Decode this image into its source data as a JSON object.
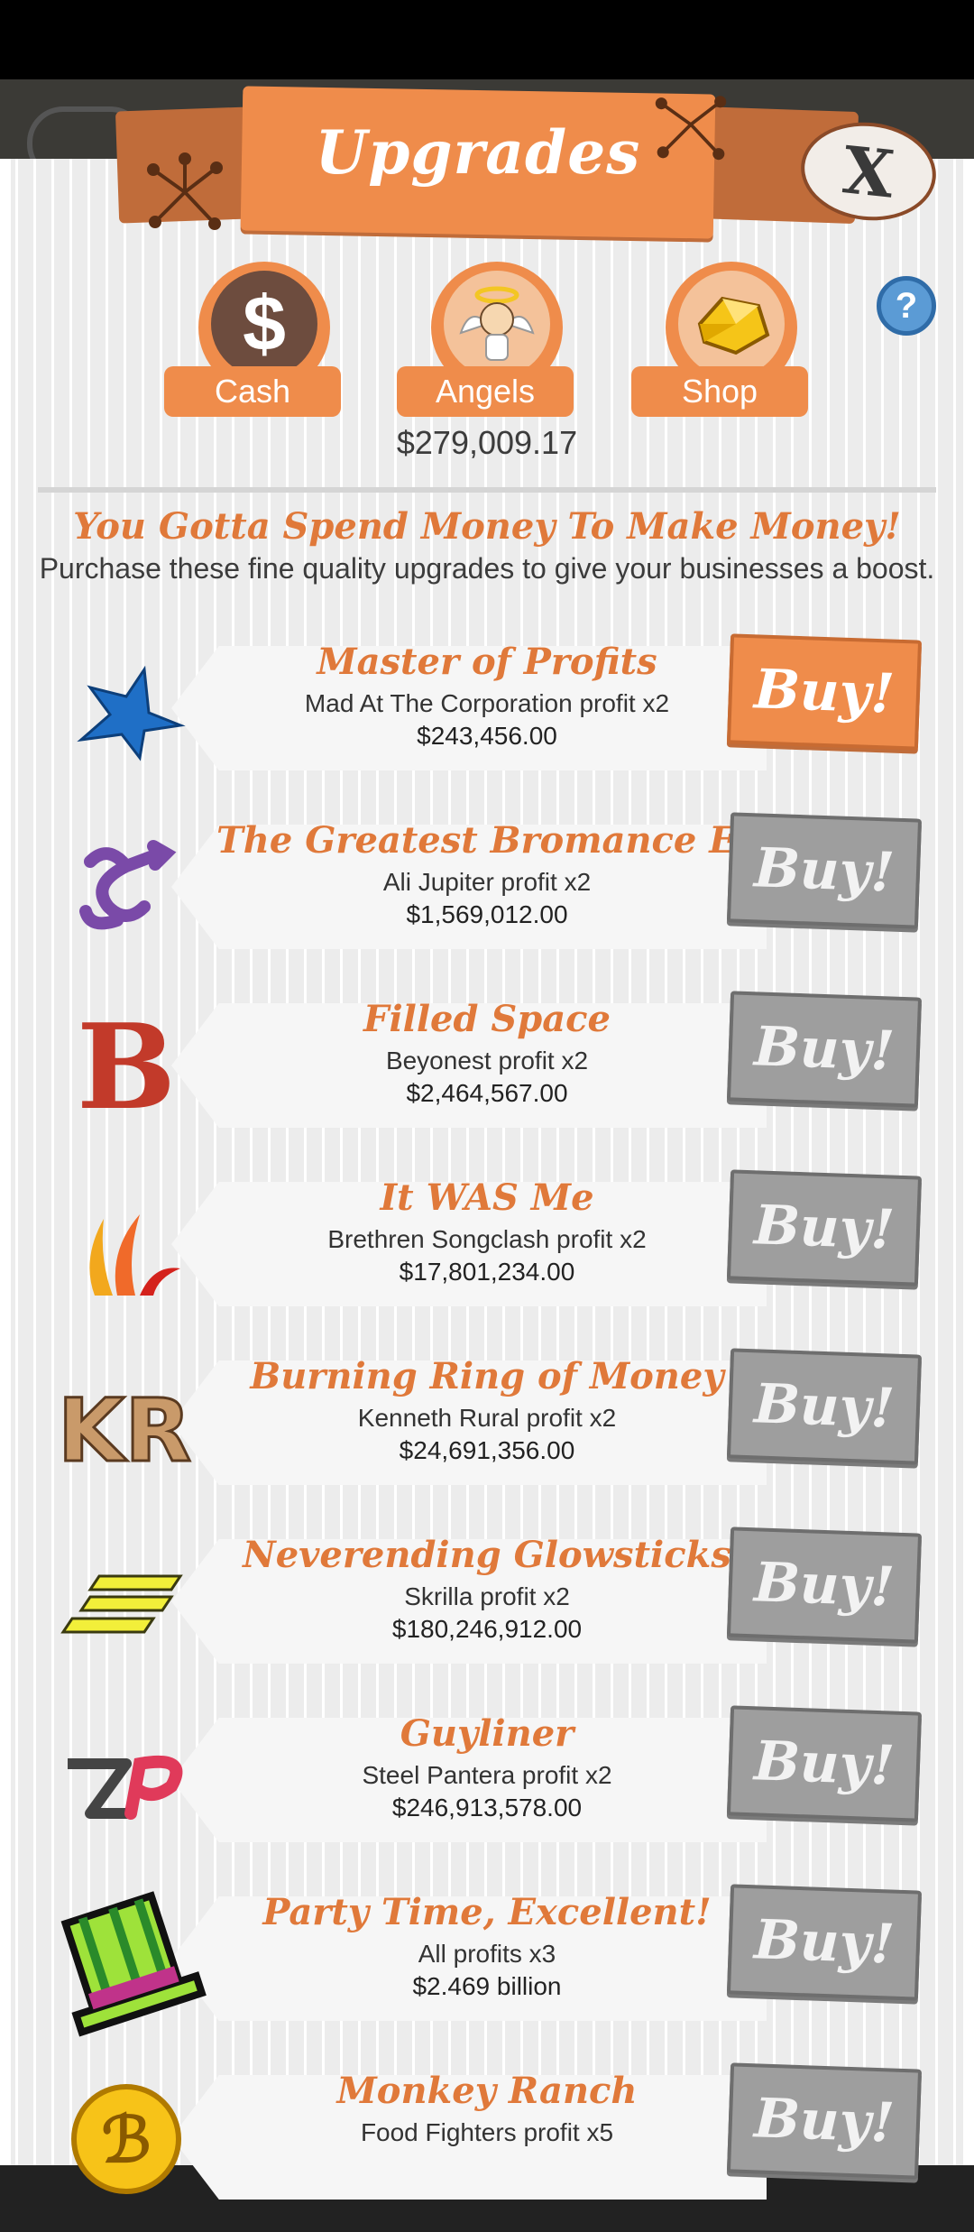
{
  "header": {
    "title": "Upgrades",
    "close_label": "X",
    "help_label": "?"
  },
  "tabs": [
    {
      "label": "Cash",
      "icon": "dollar-icon"
    },
    {
      "label": "Angels",
      "icon": "angel-icon"
    },
    {
      "label": "Shop",
      "icon": "gold-gem-icon"
    }
  ],
  "balance": "$279,009.17",
  "tagline": "You Gotta Spend Money To Make Money!",
  "subline": "Purchase these fine quality upgrades to give your businesses a boost.",
  "upgrades": [
    {
      "name": "Master of Profits",
      "desc": "Mad At The Corporation profit x2",
      "price": "$243,456.00",
      "buy": "Buy!",
      "active": true,
      "icon": "blue-star-icon"
    },
    {
      "name": "The Greatest Bromance Ever Sold",
      "desc": "Ali Jupiter profit x2",
      "price": "$1,569,012.00",
      "buy": "Buy!",
      "active": false,
      "icon": "purple-symbol-icon"
    },
    {
      "name": "Filled Space",
      "desc": "Beyonest profit x2",
      "price": "$2,464,567.00",
      "buy": "Buy!",
      "active": false,
      "icon": "letter-b-icon"
    },
    {
      "name": "It WAS Me",
      "desc": "Brethren Songclash profit x2",
      "price": "$17,801,234.00",
      "buy": "Buy!",
      "active": false,
      "icon": "flames-icon"
    },
    {
      "name": "Burning Ring of Money",
      "desc": "Kenneth Rural profit x2",
      "price": "$24,691,356.00",
      "buy": "Buy!",
      "active": false,
      "icon": "kr-logo-icon"
    },
    {
      "name": "Neverending Glowsticks",
      "desc": "Skrilla profit x2",
      "price": "$180,246,912.00",
      "buy": "Buy!",
      "active": false,
      "icon": "glowsticks-icon"
    },
    {
      "name": "Guyliner",
      "desc": "Steel Pantera profit x2",
      "price": "$246,913,578.00",
      "buy": "Buy!",
      "active": false,
      "icon": "sp-logo-icon"
    },
    {
      "name": "Party Time, Excellent!",
      "desc": "All profits x3",
      "price": "$2.469 billion",
      "buy": "Buy!",
      "active": false,
      "icon": "party-hat-icon"
    },
    {
      "name": "Monkey Ranch",
      "desc": "Food Fighters profit x5",
      "price": "",
      "buy": "Buy!",
      "active": false,
      "icon": "gold-coin-icon"
    }
  ]
}
